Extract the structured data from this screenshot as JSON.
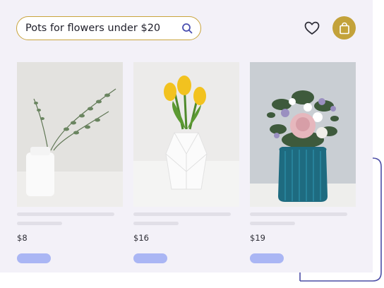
{
  "search": {
    "value": "Pots for flowers under $20"
  },
  "header": {
    "icons": [
      "search-icon",
      "heart-icon",
      "shopping-bag-icon"
    ]
  },
  "colors": {
    "accent_gold": "#c9a43c",
    "button_lavender": "#aab6f4",
    "panel_bg": "#f3f1f8",
    "deco_line": "#4c4ea6"
  },
  "products": [
    {
      "price": "$8"
    },
    {
      "price": "$16"
    },
    {
      "price": "$19"
    }
  ]
}
